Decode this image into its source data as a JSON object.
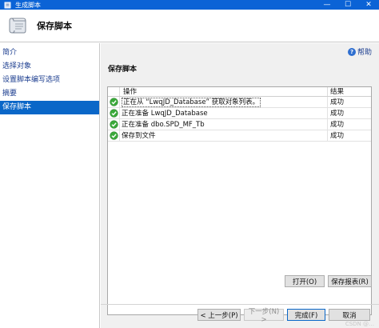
{
  "window": {
    "title": "生成脚本",
    "minimize_glyph": "—",
    "maximize_glyph": "☐",
    "close_glyph": "✕"
  },
  "header": {
    "title": "保存脚本"
  },
  "sidebar": {
    "items": [
      {
        "label": "简介"
      },
      {
        "label": "选择对象"
      },
      {
        "label": "设置脚本编写选项"
      },
      {
        "label": "摘要"
      },
      {
        "label": "保存脚本",
        "active": true
      }
    ]
  },
  "main": {
    "help_label": "帮助",
    "section_title": "保存脚本",
    "grid": {
      "columns": {
        "operation": "操作",
        "result": "结果"
      },
      "rows": [
        {
          "operation": "正在从 “LwqJD_Database” 获取对象列表。",
          "result": "成功",
          "status": "success"
        },
        {
          "operation": "正在准备 LwqJD_Database",
          "result": "成功",
          "status": "success"
        },
        {
          "operation": "正在准备 dbo.SPD_MF_Tb",
          "result": "成功",
          "status": "success"
        },
        {
          "operation": "保存到文件",
          "result": "成功",
          "status": "success"
        }
      ]
    },
    "open_button": "打开(O)",
    "save_report_button": "保存报表(R)"
  },
  "footer": {
    "prev_button": "< 上一步(P)",
    "next_button": "下一步(N) >",
    "finish_button": "完成(F)",
    "cancel_button": "取消",
    "watermark": "CSDN @…"
  },
  "colors": {
    "titlebar": "#0b63d6",
    "selection": "#0a67c8",
    "success": "#3aa93a"
  }
}
